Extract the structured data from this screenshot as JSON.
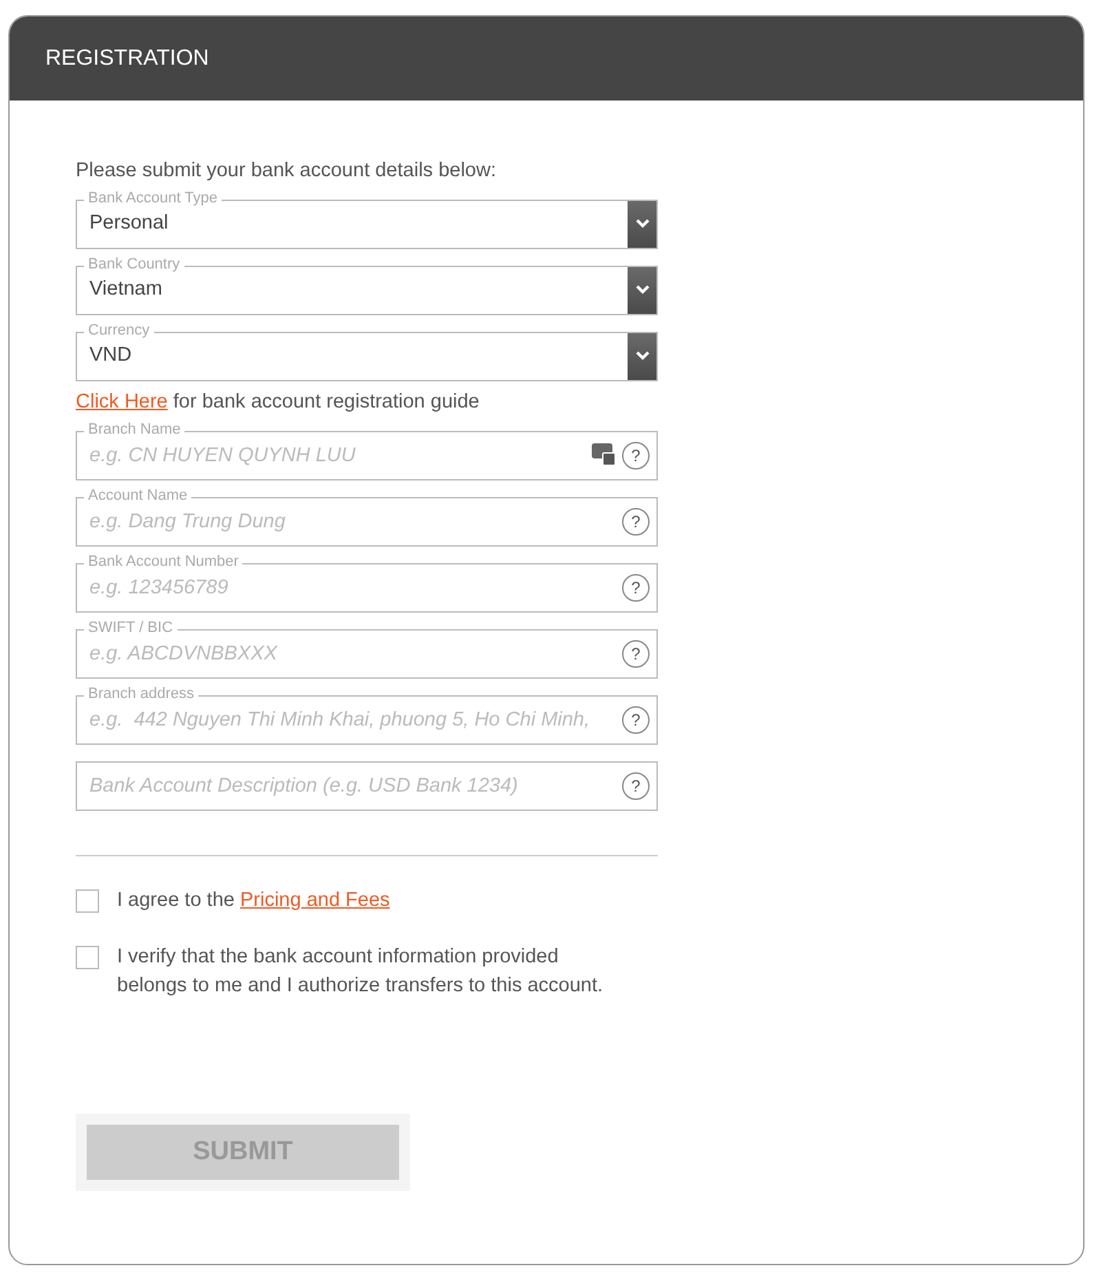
{
  "header": {
    "title": "REGISTRATION"
  },
  "intro": "Please submit your bank account details below:",
  "selects": [
    {
      "label": "Bank Account Type",
      "value": "Personal"
    },
    {
      "label": "Bank Country",
      "value": "Vietnam"
    },
    {
      "label": "Currency",
      "value": "VND"
    }
  ],
  "guide": {
    "link": "Click Here",
    "text": "for bank account registration guide"
  },
  "fields": [
    {
      "label": "Branch Name",
      "placeholder": "e.g. CN HUYEN QUYNH LUU",
      "help": "?",
      "autofill_icon": true
    },
    {
      "label": "Account Name",
      "placeholder": "e.g. Dang Trung Dung",
      "help": "?"
    },
    {
      "label": "Bank Account Number",
      "placeholder": "e.g. 123456789",
      "help": "?"
    },
    {
      "label": "SWIFT / BIC",
      "placeholder": "e.g. ABCDVNBBXXX",
      "help": "?"
    },
    {
      "label": "Branch address",
      "placeholder": "e.g.  442 Nguyen Thi Minh Khai, phuong 5, Ho Chi Minh,",
      "help": "?"
    },
    {
      "placeholder": "Bank Account Description (e.g. USD Bank 1234)",
      "help": "?"
    }
  ],
  "agreements": [
    {
      "text": "I agree to the",
      "link": "Pricing and Fees",
      "checked": false
    },
    {
      "text": "I verify that the bank account information provided belongs to me and I authorize transfers to this account.",
      "checked": false
    }
  ],
  "submit": {
    "label": "SUBMIT",
    "disabled": true
  }
}
